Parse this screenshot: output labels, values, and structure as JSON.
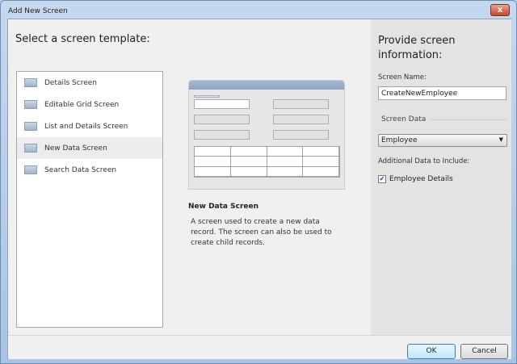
{
  "window": {
    "title": "Add New Screen",
    "close": "x"
  },
  "left": {
    "heading": "Select a screen template:",
    "templates": [
      {
        "label": "Details Screen",
        "selected": false
      },
      {
        "label": "Editable Grid Screen",
        "selected": false
      },
      {
        "label": "List and Details Screen",
        "selected": false
      },
      {
        "label": "New Data Screen",
        "selected": true
      },
      {
        "label": "Search Data Screen",
        "selected": false
      }
    ]
  },
  "preview": {
    "title": "New Data Screen",
    "description": "A screen used to create a new data record. The screen can also be used to create child records."
  },
  "right": {
    "heading": "Provide screen information:",
    "screen_name_label": "Screen Name:",
    "screen_name_value": "CreateNewEmployee",
    "screen_data_label": "Screen Data",
    "screen_data_value": "Employee",
    "additional_label": "Additional Data to Include:",
    "additional_items": [
      {
        "label": "Employee Details",
        "checked": true
      }
    ]
  },
  "buttons": {
    "ok": "OK",
    "cancel": "Cancel"
  }
}
